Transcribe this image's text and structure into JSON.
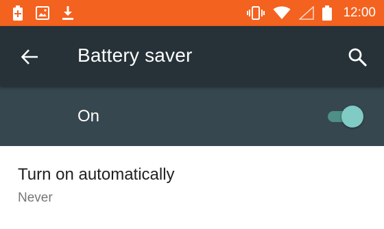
{
  "status_bar": {
    "time": "12:00",
    "icons_left": [
      "battery-saver-icon",
      "image-icon",
      "download-icon"
    ],
    "icons_right": [
      "vibrate-icon",
      "wifi-icon",
      "cellular-no-signal-icon",
      "battery-icon"
    ],
    "background": "#f4621f"
  },
  "app_bar": {
    "title": "Battery saver",
    "background": "#263238"
  },
  "master_switch": {
    "label": "On",
    "checked": true,
    "background": "#37474f",
    "accent": "#80cbc4"
  },
  "preferences": [
    {
      "title": "Turn on automatically",
      "summary": "Never"
    }
  ]
}
